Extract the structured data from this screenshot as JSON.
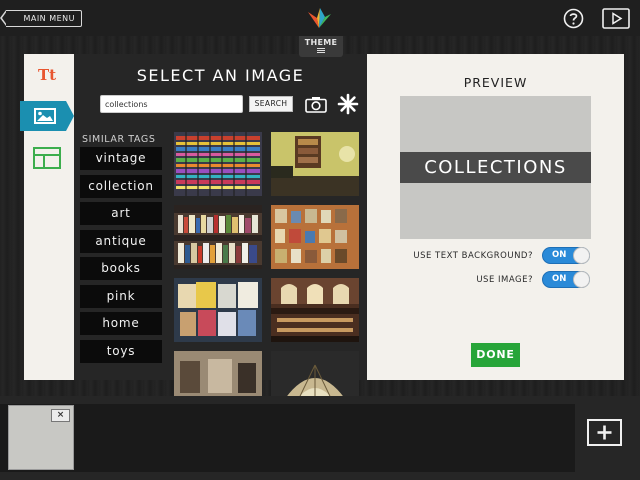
{
  "topbar": {
    "main_menu_label": "MAIN MENU",
    "icons": [
      "logo-icon",
      "help-icon",
      "play-icon"
    ]
  },
  "theme_tab": {
    "label": "THEME"
  },
  "tools": {
    "text_tool_label": "Tt",
    "icons": [
      "text-tool-icon",
      "image-tool-icon",
      "layout-tool-icon"
    ]
  },
  "select_panel": {
    "title": "SELECT AN IMAGE",
    "search": {
      "value": "collections",
      "button_label": "SEARCH"
    },
    "icons": [
      "camera-icon",
      "asterisk-icon"
    ],
    "similar_tags_title": "SIMILAR TAGS",
    "tags": [
      "vintage",
      "collection",
      "art",
      "antique",
      "books",
      "pink",
      "home",
      "toys"
    ]
  },
  "preview": {
    "title": "PREVIEW",
    "caption": "COLLECTIONS",
    "options": [
      {
        "label": "USE TEXT BACKGROUND?",
        "state": "ON"
      },
      {
        "label": "USE IMAGE?",
        "state": "ON"
      }
    ],
    "done_label": "DONE"
  },
  "bottombar": {
    "slide_close_label": "×",
    "icons": [
      "add-slide-icon"
    ]
  },
  "colors": {
    "accent_orange": "#e8552f",
    "accent_teal": "#1b8fb0",
    "toggle_blue": "#2a8ad8",
    "done_green": "#27a539"
  }
}
